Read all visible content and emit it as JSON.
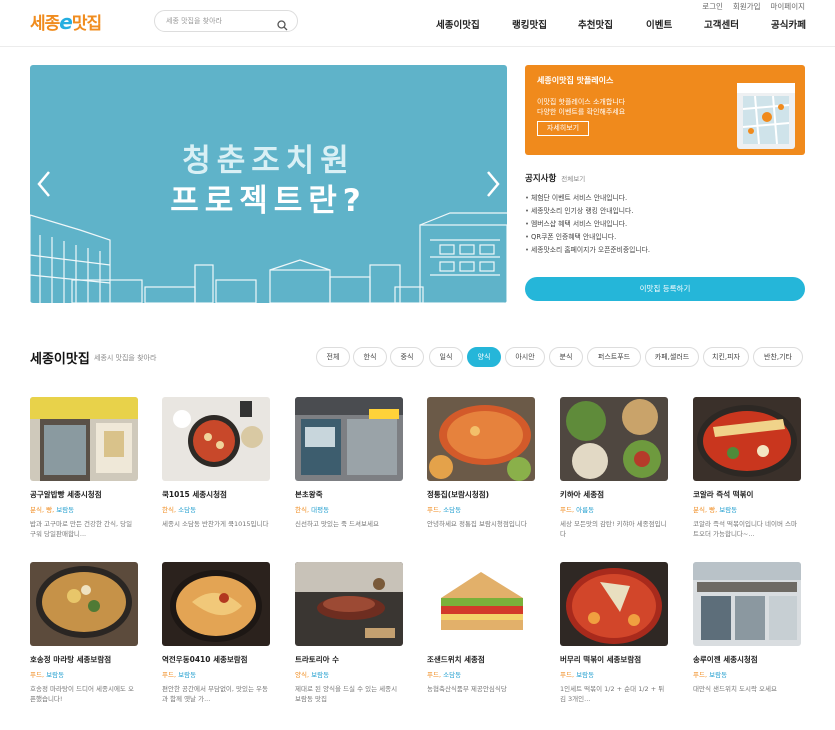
{
  "top_links": [
    "로그인",
    "회원가입",
    "마이페이지"
  ],
  "logo": {
    "part1": "세종",
    "part2": "e",
    "part3": "맛집"
  },
  "search": {
    "placeholder": "세종 맛집을 찾아라"
  },
  "nav": [
    "세종이맛집",
    "랭킹맛집",
    "추천맛집",
    "이벤트",
    "고객센터",
    "공식카페"
  ],
  "banner": {
    "line1": "청춘조치원",
    "line2": "프로젝트란?"
  },
  "promo": {
    "title": "세종이맛집 맛플레이스",
    "sub1": "이맛집 핫플레이스 소개합니다",
    "sub2": "다양한 이벤트를 확인해주세요",
    "button": "자세히보기"
  },
  "notice": {
    "title": "공지사항",
    "more": "전체보기",
    "items": [
      "체험단 이벤트 서비스 안내입니다.",
      "세종맛소리 인기상 랭킹 안내입니다.",
      "멤버스샵 혜택 서비스 안내입니다.",
      "QR쿠폰 인증혜택 안내입니다.",
      "세종맛소리 홈페이지가 오픈준비중입니다."
    ]
  },
  "register_button": "이맛집 등록하기",
  "section": {
    "title": "세종이맛집",
    "subtitle": "세종시 맛집을 찾아라"
  },
  "categories": [
    "전체",
    "한식",
    "중식",
    "일식",
    "양식",
    "아시안",
    "분식",
    "퍼스트푸드",
    "카페,샐러드",
    "치킨,피자",
    "반찬,기타"
  ],
  "active_category": "양식",
  "restaurants": [
    {
      "name": "공구알밥빵 세종시청점",
      "cat": "분식, 빵,",
      "region": "보람동",
      "desc": "밥과 고구마로 만든 건강한 간식, 당일구워 당일판매합니..."
    },
    {
      "name": "쿡1015 세종시청점",
      "cat": "한식,",
      "region": "소담동",
      "desc": "세종시 소담동 반찬가게 쿡1015입니다"
    },
    {
      "name": "본초왕죽",
      "cat": "한식,",
      "region": "대평동",
      "desc": "신선하고 맛있는 죽 드셔보세요"
    },
    {
      "name": "정통집(보람시청점)",
      "cat": "푸드,",
      "region": "소담동",
      "desc": "안녕하세요 정통집 보람시청점입니다"
    },
    {
      "name": "키햐아 세종점",
      "cat": "푸드,",
      "region": "아름동",
      "desc": "세상 모든맛의 감탄! 키햐아 세종점입니다"
    },
    {
      "name": "코알라 즉석 떡볶이",
      "cat": "분식, 빵,",
      "region": "보람동",
      "desc": "코알라 즉석 떡볶이입니다 네이버 스마트오더 가능합니다~..."
    },
    {
      "name": "호송정 마라탕 세종보람점",
      "cat": "푸드,",
      "region": "보람동",
      "desc": "호송정 마라탕이 드디어 세종시에도 오픈했습니다!"
    },
    {
      "name": "역전우동0410 세종보람점",
      "cat": "푸드,",
      "region": "보람동",
      "desc": "편안한 공간에서 부담없이, 맛있는 우동과 함께 옛날 가..."
    },
    {
      "name": "트라토리아 수",
      "cat": "양식,",
      "region": "보람동",
      "desc": "제대로 된 양식을 드실 수 있는 세종시 보람동 맛집"
    },
    {
      "name": "조샌드위치 세종점",
      "cat": "푸드,",
      "region": "소담동",
      "desc": "농협축산식품부 제공안심식당"
    },
    {
      "name": "버무리 떡볶이 세종보람점",
      "cat": "푸드,",
      "region": "보람동",
      "desc": "1인세트 떡볶이 1/2 + 순대 1/2 + 튀김 3개인..."
    },
    {
      "name": "송루이젠 세종시청점",
      "cat": "푸드,",
      "region": "보람동",
      "desc": "대만식 샌드위치 도시락 오세요"
    }
  ],
  "colors": {
    "orange": "#f08a1c",
    "teal": "#25b6d9",
    "banner": "#5fb3c9"
  }
}
